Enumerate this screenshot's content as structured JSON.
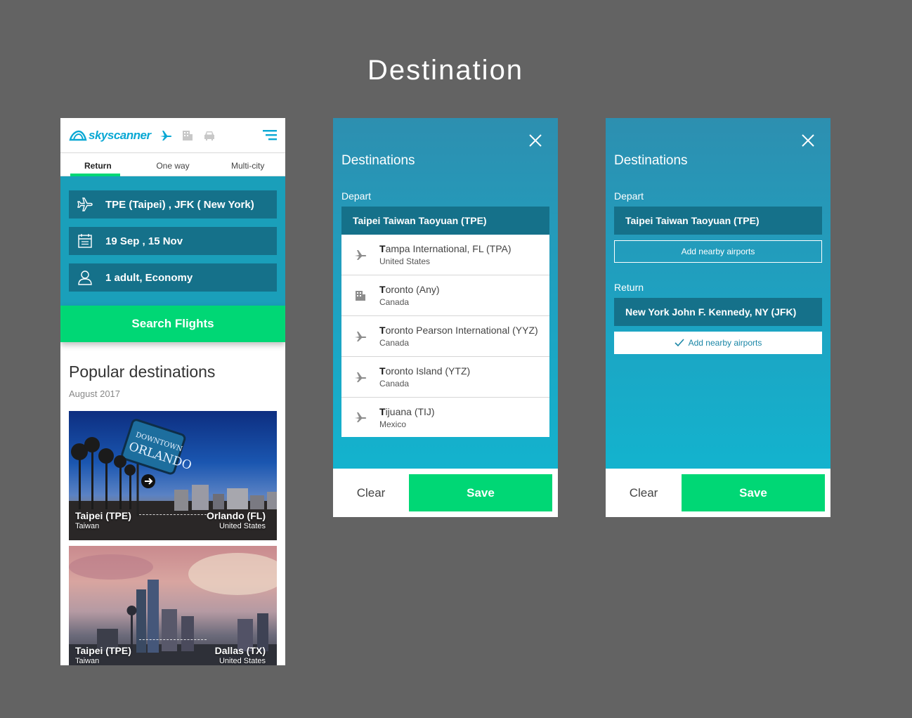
{
  "page": {
    "title": "Destination"
  },
  "phone": {
    "logo_text": "skyscanner",
    "tabs": [
      {
        "label": "Return"
      },
      {
        "label": "One way"
      },
      {
        "label": "Multi-city"
      }
    ],
    "route": "TPE (Taipei) ,  JFK ( New York)",
    "dates": "19 Sep ,  15 Nov",
    "travellers": "1 adult, Economy",
    "search_label": "Search Flights",
    "popular_title": "Popular destinations",
    "popular_date": "August 2017",
    "cards": [
      {
        "from_city": "Taipei  (TPE)",
        "from_country": "Taiwan",
        "to_city": "Orlando (FL)",
        "to_country": "United States"
      },
      {
        "from_city": "Taipei  (TPE)",
        "from_country": "Taiwan",
        "to_city": "Dallas (TX)",
        "to_country": "United States"
      }
    ]
  },
  "modal_search": {
    "title": "Destinations",
    "depart_label": "Depart",
    "depart_value": "Taipei Taiwan Taoyuan (TPE)",
    "results": [
      {
        "first": "T",
        "rest": "ampa International, FL (TPA)",
        "country": "United States",
        "icon": "plane-icon"
      },
      {
        "first": "T",
        "rest": "oronto (Any)",
        "country": "Canada",
        "icon": "city-icon"
      },
      {
        "first": "T",
        "rest": "oronto Pearson International (YYZ)",
        "country": "Canada",
        "icon": "plane-icon"
      },
      {
        "first": "T",
        "rest": "oronto Island (YTZ)",
        "country": "Canada",
        "icon": "plane-icon"
      },
      {
        "first": "T",
        "rest": "ijuana (TIJ)",
        "country": "Mexico",
        "icon": "plane-icon"
      }
    ],
    "clear_label": "Clear",
    "save_label": "Save"
  },
  "modal_selected": {
    "title": "Destinations",
    "depart_label": "Depart",
    "depart_value": "Taipei Taiwan Taoyuan (TPE)",
    "depart_nearby": "Add nearby airports",
    "return_label": "Return",
    "return_value": "New York John F. Kennedy, NY (JFK)",
    "return_nearby": "Add nearby airports",
    "clear_label": "Clear",
    "save_label": "Save"
  },
  "colors": {
    "accent_green": "#00d775",
    "teal": "#1a9fba",
    "field": "#15718a",
    "brand_blue": "#0aa8d4"
  }
}
